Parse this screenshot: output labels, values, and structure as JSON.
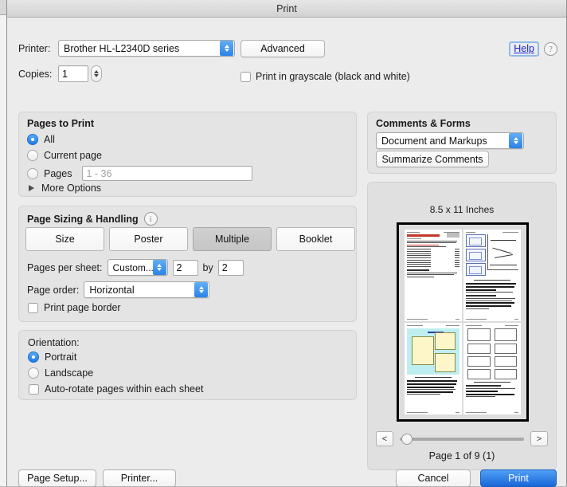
{
  "window": {
    "title": "Print"
  },
  "printer": {
    "label": "Printer:",
    "value": "Brother HL-L2340D series",
    "advanced_button": "Advanced"
  },
  "copies": {
    "label": "Copies:",
    "value": "1"
  },
  "grayscale": {
    "label": "Print in grayscale (black and white)",
    "checked": false
  },
  "help": {
    "link": "Help",
    "icon": "?"
  },
  "pages_to_print": {
    "title": "Pages to Print",
    "options": [
      {
        "label": "All",
        "selected": true
      },
      {
        "label": "Current page",
        "selected": false
      },
      {
        "label": "Pages",
        "selected": false
      }
    ],
    "pages_field_placeholder": "1 - 36",
    "more_options": "More Options"
  },
  "page_sizing": {
    "title": "Page Sizing & Handling",
    "info_icon": "i",
    "modes": [
      {
        "label": "Size",
        "selected": false
      },
      {
        "label": "Poster",
        "selected": false
      },
      {
        "label": "Multiple",
        "selected": true
      },
      {
        "label": "Booklet",
        "selected": false
      }
    ],
    "pages_per_sheet_label": "Pages per sheet:",
    "pages_per_sheet_value": "Custom...",
    "cols": "2",
    "by_label": "by",
    "rows": "2",
    "page_order_label": "Page order:",
    "page_order_value": "Horizontal",
    "print_page_border": "Print page border"
  },
  "orientation": {
    "title": "Orientation:",
    "options": [
      {
        "label": "Portrait",
        "selected": true
      },
      {
        "label": "Landscape",
        "selected": false
      }
    ],
    "auto_rotate": "Auto-rotate pages within each sheet"
  },
  "comments_forms": {
    "title": "Comments & Forms",
    "value": "Document and Markups",
    "summarize_button": "Summarize Comments"
  },
  "preview": {
    "paper_size": "8.5 x 11 Inches",
    "prev_button": "<",
    "next_button": ">",
    "page_count": "Page 1 of 9 (1)"
  },
  "footer": {
    "page_setup": "Page Setup...",
    "printer": "Printer...",
    "cancel": "Cancel",
    "print": "Print"
  },
  "colors": {
    "accent_blue": "#1967d8",
    "dialog_bg": "#ececec",
    "group_bg": "#e4e4e4",
    "link_blue": "#1a24d8"
  }
}
